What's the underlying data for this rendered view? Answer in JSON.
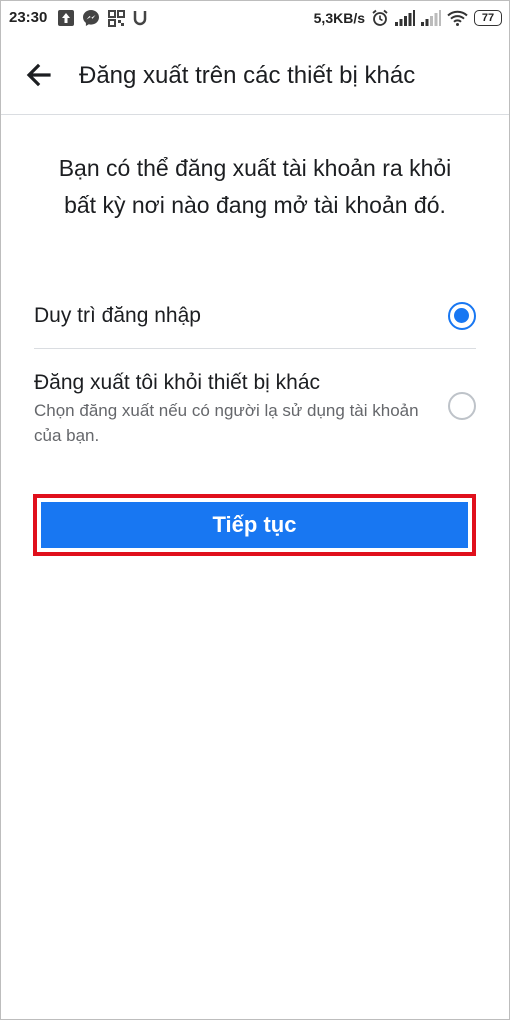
{
  "status_bar": {
    "time": "23:30",
    "net_speed": "5,3KB/s",
    "battery": "77",
    "left_icons": [
      "upload-icon",
      "messenger-icon",
      "apps-icon",
      "u-icon"
    ],
    "right_icons": [
      "alarm-icon",
      "signal-icon",
      "signal-icon",
      "wifi-icon",
      "battery-icon"
    ]
  },
  "header": {
    "title": "Đăng xuất trên các thiết bị khác"
  },
  "description": "Bạn có thể đăng xuất tài khoản ra khỏi bất kỳ nơi nào đang mở tài khoản đó.",
  "options": [
    {
      "label": "Duy trì đăng nhập",
      "selected": true
    },
    {
      "label": "Đăng xuất tôi khỏi thiết bị khác",
      "sublabel": "Chọn đăng xuất nếu có người lạ sử dụng tài khoản của bạn.",
      "selected": false
    }
  ],
  "button": {
    "label": "Tiếp tục"
  },
  "colors": {
    "accent": "#1877f2",
    "highlight_border": "#e0101c"
  }
}
